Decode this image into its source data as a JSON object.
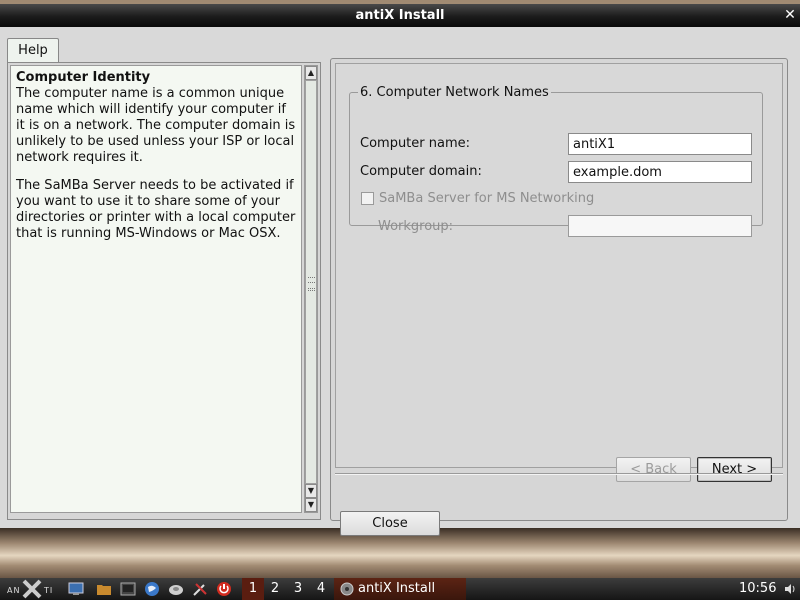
{
  "window": {
    "title": "antiX Install",
    "close_glyph": "✕"
  },
  "help": {
    "tab_label": "Help",
    "title": "Computer Identity",
    "paragraph1": "The computer name is a common unique name which will identify your computer if it is on a network. The computer domain is unlikely to be used unless your ISP or local network requires it.",
    "paragraph2": "The SaMBa Server needs to be activated if you want to use it to share some of your directories or printer with a local computer that is running MS-Windows or Mac OSX."
  },
  "network": {
    "group_title": "6. Computer Network Names",
    "computer_name_label": "Computer name:",
    "computer_name_value": "antiX1",
    "computer_domain_label": "Computer domain:",
    "computer_domain_value": "example.dom",
    "samba_label": "SaMBa Server for MS Networking",
    "samba_checked": false,
    "workgroup_label": "Workgroup:",
    "workgroup_value": ""
  },
  "buttons": {
    "back": "< Back",
    "next_underlined": "N",
    "next_rest": "ext >",
    "close": "Close"
  },
  "taskbar": {
    "logo_text": "ANTI",
    "workspaces": [
      "1",
      "2",
      "3",
      "4"
    ],
    "active_workspace": "1",
    "task_label": "antiX Install",
    "clock": "10:56",
    "tray_icon": "speaker-icon",
    "launcher_icons": [
      "desktop-icon",
      "folder-icon",
      "terminal-icon",
      "browser-icon",
      "disk-icon",
      "tools-icon",
      "power-icon"
    ]
  }
}
